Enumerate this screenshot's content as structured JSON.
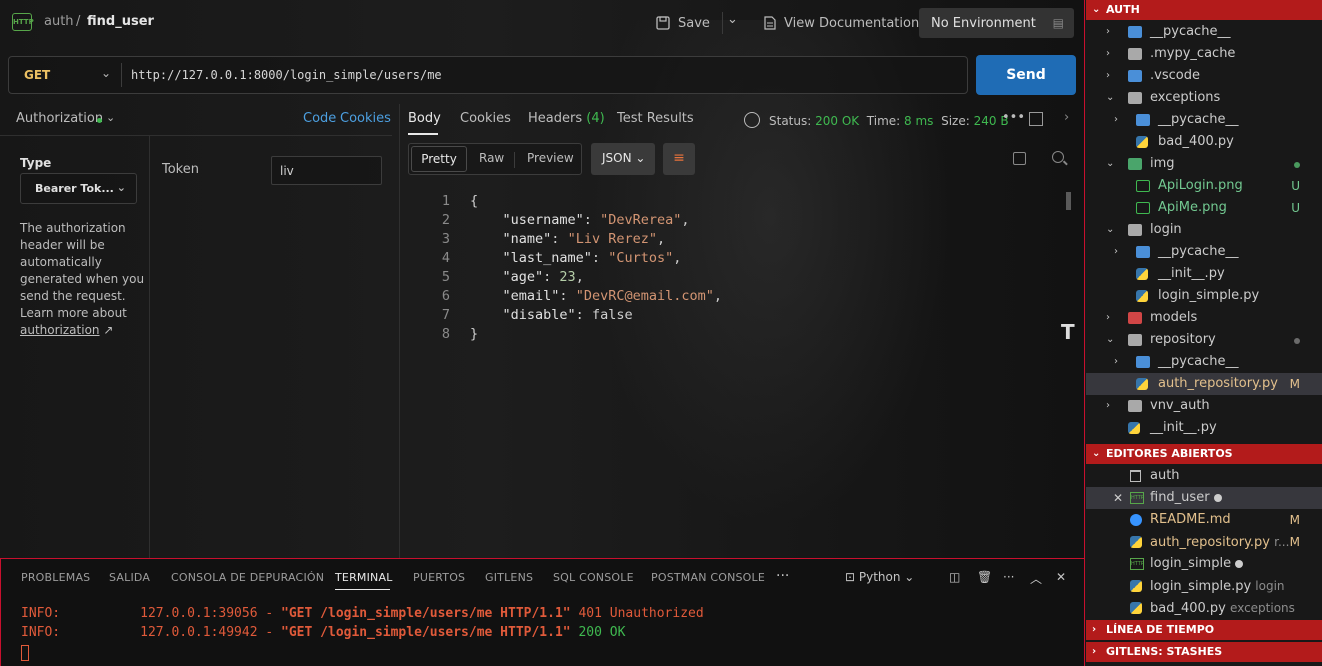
{
  "postman": {
    "breadcrumb": {
      "parent": "auth",
      "separator": "/",
      "current": "find_user",
      "badge": "HTTP"
    },
    "toolbar": {
      "save": "Save",
      "view_docs": "View Documentation",
      "environment": "No Environment"
    },
    "request": {
      "method": "GET",
      "url": "http://127.0.0.1:8000/login_simple/users/me",
      "send": "Send"
    },
    "auth": {
      "tab_label": "Authorization",
      "code": "Code",
      "cookies": "Cookies",
      "type_label": "Type",
      "type_value": "Bearer Tok...",
      "help_text": "The authorization header will be automatically generated when you send the request. Learn more about",
      "help_link": "authorization",
      "token_label": "Token",
      "token_value": "liv"
    },
    "response": {
      "tabs": {
        "body": "Body",
        "cookies": "Cookies",
        "headers": "Headers",
        "headers_count": "(4)",
        "tests": "Test Results"
      },
      "status_label": "Status:",
      "status_value": "200 OK",
      "time_label": "Time:",
      "time_value": "8 ms",
      "size_label": "Size:",
      "size_value": "240 B",
      "formats": {
        "pretty": "Pretty",
        "raw": "Raw",
        "preview": "Preview",
        "type": "JSON"
      },
      "line_numbers": [
        "1",
        "2",
        "3",
        "4",
        "5",
        "6",
        "7",
        "8"
      ],
      "json_body": {
        "open": "{",
        "close": "}",
        "username_key": "\"username\"",
        "username_val": "\"DevRerea\"",
        "name_key": "\"name\"",
        "name_val": "\"Liv Rerez\"",
        "last_name_key": "\"last_name\"",
        "last_name_val": "\"Curtos\"",
        "age_key": "\"age\"",
        "age_val": "23",
        "email_key": "\"email\"",
        "email_val": "\"DevRC@email.com\"",
        "disable_key": "\"disable\"",
        "disable_val": "false"
      }
    }
  },
  "terminal": {
    "tabs": [
      "PROBLEMAS",
      "SALIDA",
      "CONSOLA DE DEPURACIÓN",
      "TERMINAL",
      "PUERTOS",
      "GITLENS",
      "SQL CONSOLE",
      "POSTMAN CONSOLE"
    ],
    "active_tab": "TERMINAL",
    "shell": "Python",
    "lines": [
      {
        "level": "INFO:",
        "addr": "127.0.0.1:39056",
        "dash": "-",
        "request": "\"GET /login_simple/users/me HTTP/1.1\"",
        "status": "401 Unauthorized"
      },
      {
        "level": "INFO:",
        "addr": "127.0.0.1:49942",
        "dash": "-",
        "request": "\"GET /login_simple/users/me HTTP/1.1\"",
        "status": "200 OK"
      }
    ]
  },
  "explorer": {
    "root": "AUTH",
    "tree": [
      {
        "label": "__pycache__",
        "badge": ""
      },
      {
        "label": ".mypy_cache",
        "badge": ""
      },
      {
        "label": ".vscode",
        "badge": ""
      },
      {
        "label": "exceptions",
        "badge": ""
      },
      {
        "label": "__pycache__",
        "badge": ""
      },
      {
        "label": "bad_400.py",
        "badge": ""
      },
      {
        "label": "img",
        "badge": ""
      },
      {
        "label": "ApiLogin.png",
        "badge": "U"
      },
      {
        "label": "ApiMe.png",
        "badge": "U"
      },
      {
        "label": "login",
        "badge": ""
      },
      {
        "label": "__pycache__",
        "badge": ""
      },
      {
        "label": "__init__.py",
        "badge": ""
      },
      {
        "label": "login_simple.py",
        "badge": ""
      },
      {
        "label": "models",
        "badge": ""
      },
      {
        "label": "repository",
        "badge": ""
      },
      {
        "label": "__pycache__",
        "badge": ""
      },
      {
        "label": "auth_repository.py",
        "badge": "M"
      },
      {
        "label": "vnv_auth",
        "badge": ""
      },
      {
        "label": "__init__.py",
        "badge": ""
      }
    ],
    "open_editors_title": "EDITORES ABIERTOS",
    "open_editors": [
      {
        "label": "auth",
        "detail": "",
        "badge": ""
      },
      {
        "label": "find_user",
        "detail": "",
        "badge": ""
      },
      {
        "label": "README.md",
        "detail": "",
        "badge": "M"
      },
      {
        "label": "auth_repository.py",
        "detail": "r...",
        "badge": "M"
      },
      {
        "label": "login_simple",
        "detail": "",
        "badge": ""
      },
      {
        "label": "login_simple.py",
        "detail": "login",
        "badge": ""
      },
      {
        "label": "bad_400.py",
        "detail": "exceptions",
        "badge": ""
      }
    ],
    "timeline_title": "LÍNEA DE TIEMPO",
    "stashes_title": "GITLENS: STASHES"
  }
}
